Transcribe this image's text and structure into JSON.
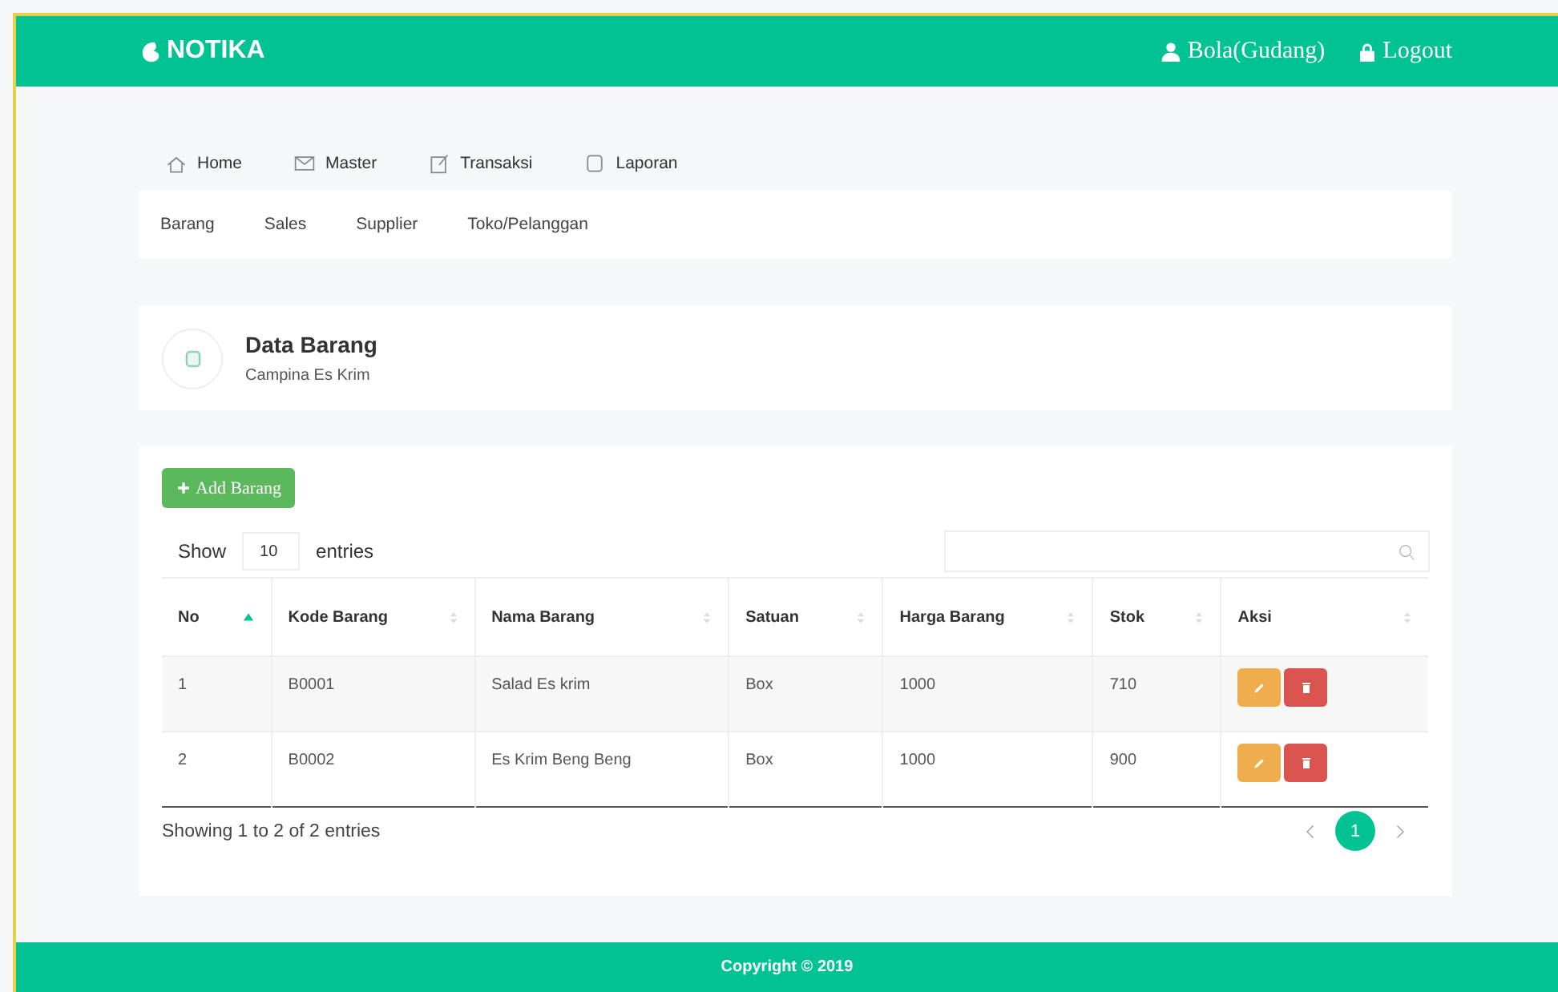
{
  "header": {
    "brand": "NOTIKA",
    "user": "Bola(Gudang)",
    "logout": "Logout"
  },
  "main_menu": [
    {
      "label": "Home"
    },
    {
      "label": "Master"
    },
    {
      "label": "Transaksi"
    },
    {
      "label": "Laporan"
    }
  ],
  "sub_menu": [
    "Barang",
    "Sales",
    "Supplier",
    "Toko/Pelanggan"
  ],
  "page_title": {
    "title": "Data Barang",
    "subtitle": "Campina Es Krim"
  },
  "add_button": "Add Barang",
  "length": {
    "before": "Show",
    "value": "10",
    "after": "entries"
  },
  "table": {
    "columns": [
      {
        "label": "No",
        "sorted": true
      },
      {
        "label": "Kode Barang",
        "sorted": false
      },
      {
        "label": "Nama Barang",
        "sorted": false
      },
      {
        "label": "Satuan",
        "sorted": false
      },
      {
        "label": "Harga Barang",
        "sorted": false
      },
      {
        "label": "Stok",
        "sorted": false
      },
      {
        "label": "Aksi",
        "sorted": false
      }
    ],
    "rows": [
      [
        "1",
        "B0001",
        "Salad Es krim",
        "Box",
        "1000",
        "710"
      ],
      [
        "2",
        "B0002",
        "Es Krim Beng Beng",
        "Box",
        "1000",
        "900"
      ]
    ]
  },
  "info": "Showing 1 to 2 of 2 entries",
  "pagination": [
    {
      "label": "1",
      "selected": true
    }
  ],
  "footer": "Copyright © 2019"
}
